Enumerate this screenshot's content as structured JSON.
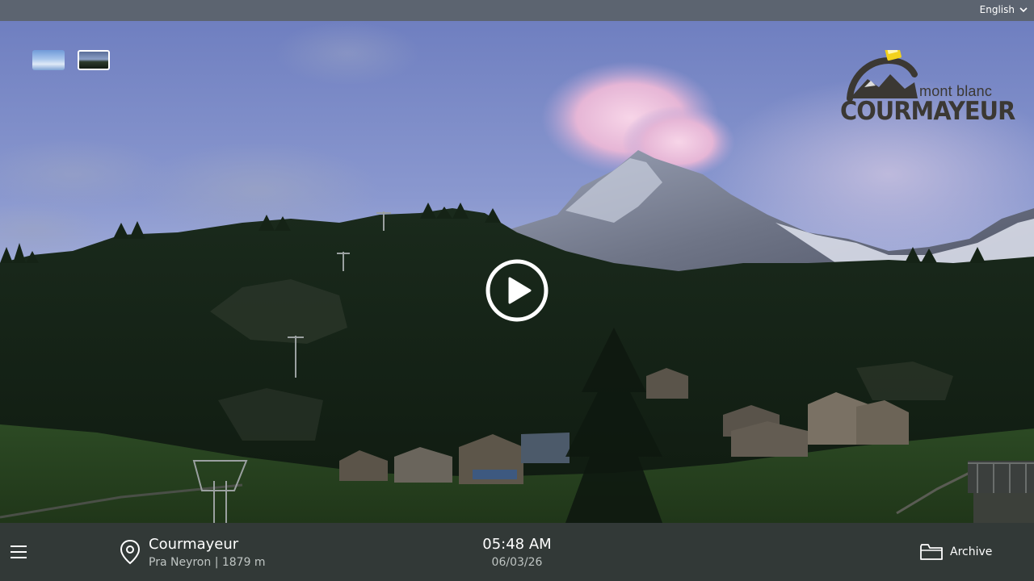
{
  "header": {
    "language_label": "English"
  },
  "player": {
    "thumbnails": [
      {
        "icon": "day-sky-thumbnail"
      },
      {
        "icon": "dawn-mountain-thumbnail"
      }
    ],
    "logo": {
      "top_line": "mont blanc",
      "main_line": "COURMAYEUR"
    },
    "play_icon": "play-icon"
  },
  "footer": {
    "location_name": "Courmayeur",
    "location_sub": "Pra Neyron | 1879 m",
    "time": "05:48 AM",
    "date": "06/03/26",
    "archive_label": "Archive"
  },
  "colors": {
    "topbar": "#5c6470",
    "bottombar": "#343c3a",
    "logo_accent": "#f2d21c"
  }
}
